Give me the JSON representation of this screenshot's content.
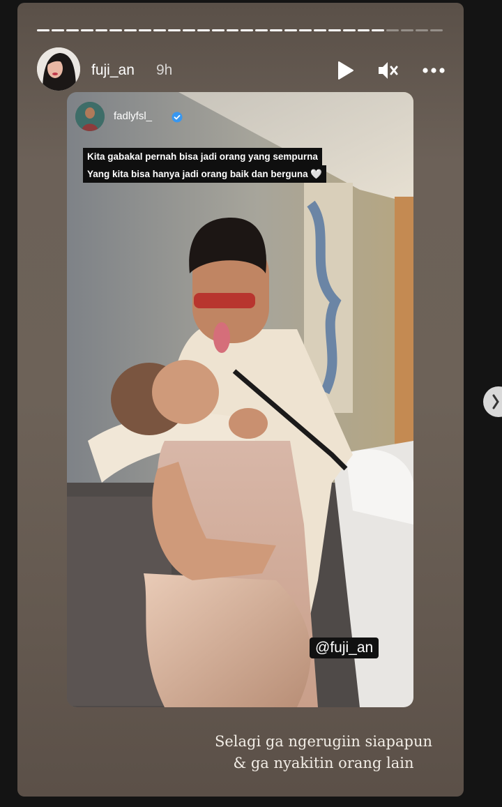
{
  "story": {
    "progress_total": 28,
    "progress_done": 24,
    "author": {
      "username": "fuji_an",
      "time_ago": "9h"
    },
    "controls": {
      "play": "play-icon",
      "mute": "muted-icon",
      "more": "more-icon"
    }
  },
  "reshared_post": {
    "original_author": "fadlyfsl_",
    "caption_lines": [
      "Kita gabakal pernah bisa jadi orang yang sempurna",
      "Yang kita bisa hanya jadi orang baik dan berguna 🤍"
    ],
    "mention_tag": "@fuji_an"
  },
  "story_text": {
    "lines": [
      "Selagi ga ngerugiin siapapun",
      "& ga nyakitin orang lain"
    ]
  },
  "colors": {
    "verified": "#3897f0",
    "background": "#141414"
  }
}
